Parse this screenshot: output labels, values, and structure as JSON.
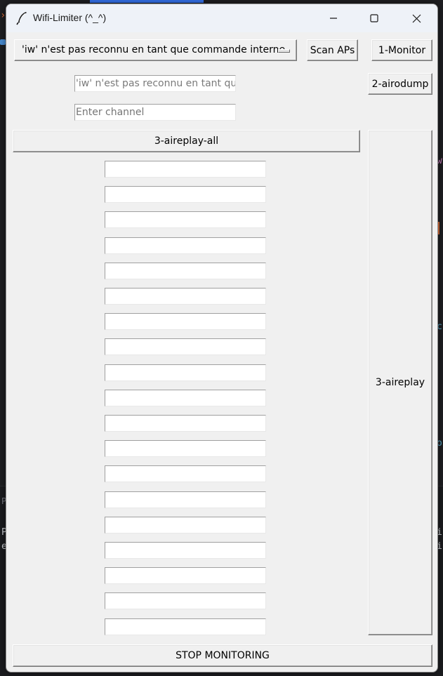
{
  "window": {
    "title": "Wifi-Limiter (^_^)"
  },
  "controls": {
    "interface_dropdown_value": "'iw' n'est pas reconnu en tant que commande interne",
    "scan_aps_label": "Scan APs",
    "monitor_label": "1-Monitor",
    "airodump_label": "2-airodump",
    "interface_entry_value": "'iw' n'est pas reconnu en tant que",
    "channel_placeholder": "Enter channel",
    "aireplay_all_label": "3-aireplay-all",
    "aireplay_label": "3-aireplay",
    "stop_monitoring_label": "STOP MONITORING"
  },
  "target_entries": [
    "",
    "",
    "",
    "",
    "",
    "",
    "",
    "",
    "",
    "",
    "",
    "",
    "",
    "",
    "",
    "",
    "",
    "",
    ""
  ],
  "background_fragments": {
    "right_1": "w",
    "right_2": "c",
    "right_3": "o",
    "panel_label": "P",
    "panel_left_1": "P",
    "panel_left_2": "e",
    "panel_right_1": "i",
    "panel_right_2": "i"
  },
  "colors": {
    "window_bg": "#f0f0f0",
    "titlebar_bg": "#eef2f8",
    "editor_bg": "#1e1f22",
    "accent": "#3574f0"
  }
}
